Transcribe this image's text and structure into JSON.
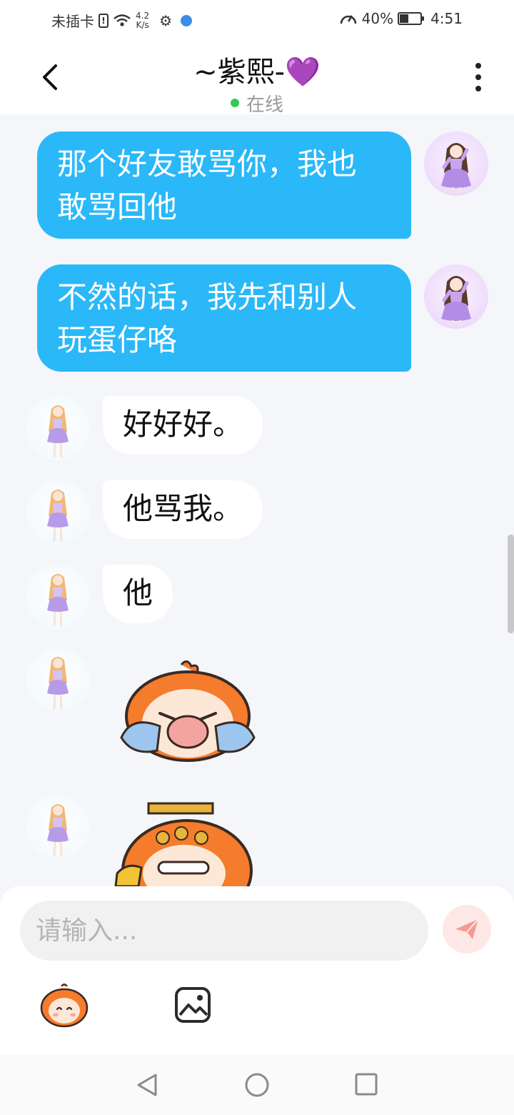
{
  "status_bar": {
    "carrier": "未插卡",
    "net_speed_value": "4.2",
    "net_speed_unit": "K/s",
    "battery": "40%",
    "time": "4:51"
  },
  "header": {
    "title": "~紫熙-",
    "title_emoji": "💜",
    "status": "在线"
  },
  "messages": [
    {
      "direction": "outgoing",
      "text_line1": "那个好友敢骂你，我也",
      "text_line2": "敢骂回他"
    },
    {
      "direction": "outgoing",
      "text_line1": "不然的话，我先和别人",
      "text_line2": "玩蛋仔咯"
    },
    {
      "direction": "incoming",
      "text": "好好好。"
    },
    {
      "direction": "incoming",
      "text": "他骂我。"
    },
    {
      "direction": "incoming",
      "text": "他"
    },
    {
      "direction": "incoming",
      "sticker": "crying-eggy-sticker"
    },
    {
      "direction": "incoming",
      "sticker": "emperor-eggy-sticker"
    }
  ],
  "composer": {
    "placeholder": "请输入..."
  },
  "colors": {
    "accent_blue": "#2ab8f8",
    "online_green": "#34c759",
    "send_pink": "#f59a92"
  }
}
